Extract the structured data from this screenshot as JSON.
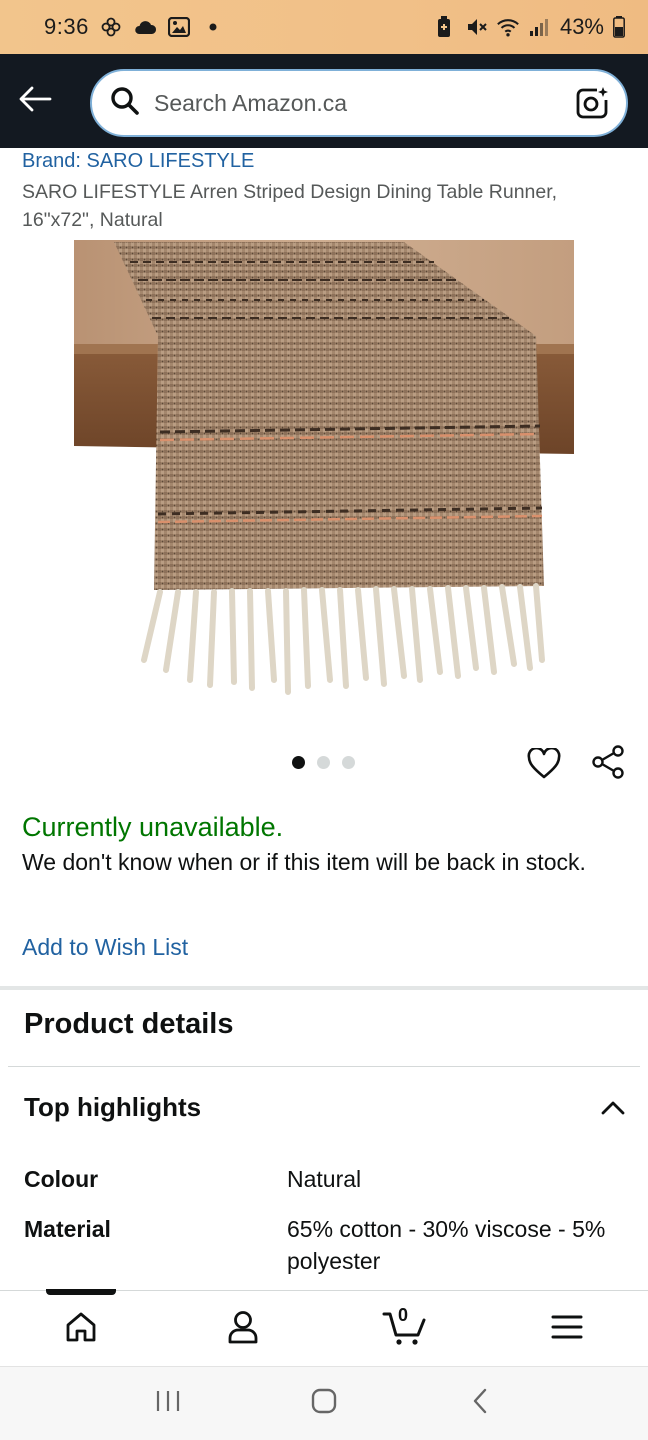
{
  "status_bar": {
    "time": "9:36",
    "battery": "43%",
    "icons_left": [
      "pinwheel-icon",
      "cloud-icon",
      "image-icon",
      "dot-icon"
    ],
    "icons_right": [
      "battery-saver-icon",
      "mute-icon",
      "wifi-icon",
      "signal-icon",
      "battery-icon"
    ]
  },
  "header": {
    "back_icon": "arrow-left-icon",
    "search_placeholder": "Search Amazon.ca",
    "search_icon": "search-icon",
    "camera_icon": "camera-search-icon"
  },
  "product": {
    "brand": "Brand: SARO LIFESTYLE",
    "title": "SARO LIFESTYLE Arren Striped Design Dining Table Runner, 16\"x72\", Natural",
    "image_alt": "table-runner-photo",
    "carousel": {
      "total": 3,
      "active": 0
    },
    "availability": "Currently unavailable.",
    "stock_message": "We don't know when or if this item will be back in stock.",
    "wish_list_link": "Add to Wish List"
  },
  "details": {
    "heading": "Product details",
    "highlights_title": "Top highlights",
    "specs": [
      {
        "key": "Colour",
        "value": "Natural"
      },
      {
        "key": "Material",
        "value": "65% cotton - 30% viscose - 5% polyester"
      }
    ]
  },
  "bottom_nav": {
    "items": [
      "home-icon",
      "account-icon",
      "cart-icon",
      "menu-icon"
    ],
    "cart_count": "0"
  },
  "android_nav": {
    "items": [
      "recents-icon",
      "home-circle-icon",
      "back-chevron-icon"
    ]
  },
  "colors": {
    "status_bar": "#f2c58c",
    "header_bg": "#131921",
    "link": "#2162a1",
    "available_green": "#007600"
  }
}
